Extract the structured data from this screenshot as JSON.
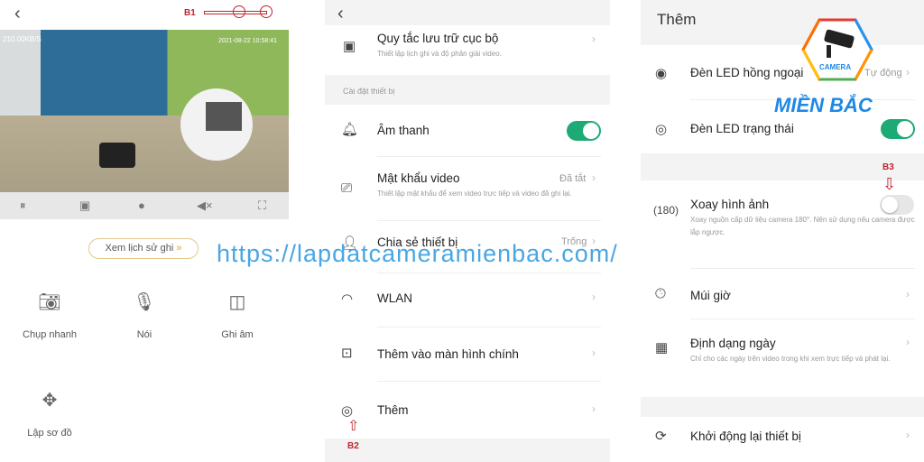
{
  "panel1": {
    "back_icon": "chevron-left-icon",
    "annotation": "B1",
    "video": {
      "bitrate": "210.00KB/S",
      "timestamp": "2021-08-22 10:58:41"
    },
    "controls": [
      "pause-icon",
      "stop-icon",
      "hd-icon",
      "mute-icon",
      "fullscreen-icon"
    ],
    "history_button": "Xem lịch sử ghi",
    "history_chevron": "»",
    "actions": [
      {
        "label": "Chụp nhanh",
        "icon": "camera-icon"
      },
      {
        "label": "Nói",
        "icon": "microphone-icon"
      },
      {
        "label": "Ghi âm",
        "icon": "record-icon"
      },
      {
        "label": "Lập sơ đồ",
        "icon": "move-icon"
      }
    ]
  },
  "panel2": {
    "storage": {
      "title": "Quy tắc lưu trữ cục bộ",
      "subtitle": "Thiết lập lịch ghi và độ phân giải video."
    },
    "section": "Cài đặt thiết bị",
    "sound": {
      "title": "Âm thanh",
      "enabled": true
    },
    "password": {
      "title": "Mật khẩu video",
      "value": "Đã tắt",
      "subtitle": "Thiết lập mật khẩu để xem video trực tiếp và video đã ghi lại."
    },
    "share": {
      "title": "Chia sẻ thiết bị",
      "value": "Trống"
    },
    "wlan": {
      "title": "WLAN"
    },
    "homescreen": {
      "title": "Thêm vào màn hình chính"
    },
    "more": {
      "title": "Thêm"
    },
    "annotation": "B2"
  },
  "panel3": {
    "title": "Thêm",
    "ir_led": {
      "title": "Đèn LED hồng ngoại",
      "value": "Tự động"
    },
    "status_led": {
      "title": "Đèn LED trạng thái",
      "enabled": true
    },
    "annotation": "B3",
    "rotate": {
      "title": "Xoay hình ảnh",
      "enabled": false,
      "subtitle": "Xoay nguồn cấp dữ liệu camera 180°. Nên sử dụng nếu camera được lắp ngược."
    },
    "timezone": {
      "title": "Múi giờ"
    },
    "date_format": {
      "title": "Định dạng ngày",
      "subtitle": "Chỉ cho các ngày trên video trong khi xem trực tiếp và phát lại."
    },
    "reboot": {
      "title": "Khởi động lại thiết bị"
    }
  },
  "watermark": {
    "url": "https://lapdatcameramienbac.com/",
    "logo_badge": "CAMERA",
    "logo_text": "MIỀN BẮC"
  },
  "colors": {
    "toggle_on": "#1eaa75",
    "annotation": "#c0262e",
    "watermark": "#4aa6e2"
  }
}
